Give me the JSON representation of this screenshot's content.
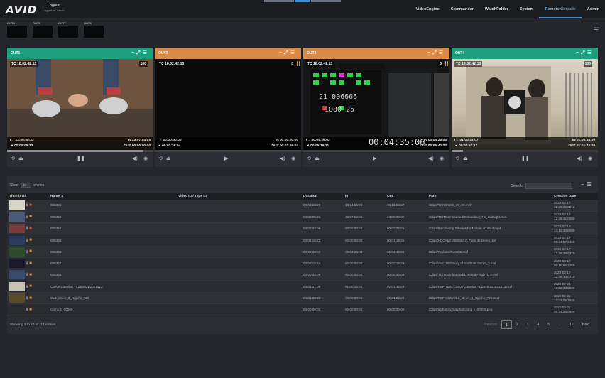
{
  "brand": {
    "logo": "AVID"
  },
  "user": {
    "name": "Logout",
    "status": "Logged as admin"
  },
  "nav": [
    "VideoEngine",
    "Commander",
    "WatchFolder",
    "System",
    "Remote Console",
    "Admin"
  ],
  "nav_active": "Remote Console",
  "outputs": [
    "OUT5",
    "OUT6",
    "OUT7",
    "OUT8"
  ],
  "channels": [
    {
      "name": "OUT1",
      "color": "#1f9e7d",
      "tc": "TC 18:02:42:13",
      "badge": "100",
      "l1": "I→ 23:59:58:33",
      "l2": "◄ 00:00:09:33",
      "r1": "IN 23:57:54:05",
      "r2": "OUT 00:00:00:00",
      "progress": 0.93
    },
    {
      "name": "OUT2",
      "color": "#d98b4a",
      "tc": "TC 18:02:42:13",
      "badge": "0",
      "l1": "I→ 00:00:00:00",
      "l2": "◄ 00:02:26:04",
      "r1": "IN 00:00:00:00",
      "r2": "OUT 00:02:26:04",
      "progress": 0.0
    },
    {
      "name": "OUT3",
      "color": "#d98b4a",
      "tc": "TC 18:02:42:13",
      "badge": "0",
      "l1": "I→ 00:04:25:03",
      "l2": "◄ 00:05:19:21",
      "r1": "IN 00:04:25:03",
      "r2": "OUT 00:05:44:04",
      "progress": 0.0,
      "overlay_tc": "00:04:35:06"
    },
    {
      "name": "OUT4",
      "color": "#1f9e7d",
      "tc": "TC 18:02:42:13",
      "badge": "100",
      "l1": "I→ 01:00:22:07",
      "l2": "◄ 00:00:51:17",
      "r1": "IN 01:00:15:00",
      "r2": "OUT 01:01:42:08",
      "progress": 0.08
    }
  ],
  "table": {
    "show_label": "Show",
    "show_value": "10",
    "entries_label": "entries",
    "search_label": "Search:",
    "columns": [
      "Thumbnail",
      "Name ▲",
      "Video ID / Tape ID",
      "Duration",
      "In",
      "Out",
      "Path",
      "Creation Date"
    ],
    "rows": [
      {
        "thumb": "#d8d4c8",
        "name": "005352",
        "duration": "00:04:23:26",
        "in": "16:14:55:56",
        "out": "16:19:23:27",
        "path": "/Clips/TC/720p50_s5_15.mxf",
        "date1": "2022-02-17",
        "date2": "12:29:29.0013",
        "lock": "lock-r"
      },
      {
        "thumb": "#4a5a7a",
        "name": "005353",
        "duration": "00:02:05:21",
        "in": "23:57:54:05",
        "out": "24:00:00:00",
        "path": "/Clips/TC/TCembedded/Embedded_TC_midnight.mov",
        "date1": "2022-02-17",
        "date2": "12:28:42.0080",
        "lock": "lock-o"
      },
      {
        "thumb": "#7a3a3a",
        "name": "005354",
        "duration": "00:02:26:06",
        "in": "00:00:00:00",
        "out": "00:02:26:05",
        "path": "/Clips/Introducing Sibelius for Mobile on iPad.mp4",
        "date1": "2022-02-17",
        "date2": "14:13:20.6090",
        "lock": "lock-r"
      },
      {
        "thumb": "#2a3a5a",
        "name": "005355",
        "duration": "00:01:16:22",
        "in": "00:00:00:00",
        "out": "00:01:16:21",
        "path": "/Clips/HDCAM/1080i50/LG Paris 4k Demo.mxf",
        "date1": "2022-02-17",
        "date2": "09:34:57.3420",
        "lock": "lock-o"
      },
      {
        "thumb": "#2c4a2c",
        "name": "005356",
        "duration": "00:00:20:00",
        "in": "00:04:25:04",
        "out": "00:04:45:03",
        "path": "/Clips/Pro/arte/Ruc026.mxf",
        "date1": "2022-02-17",
        "date2": "13:38:28.6370",
        "lock": "lock-o"
      },
      {
        "thumb": "#1a1a2a",
        "name": "005357",
        "duration": "00:02:15:24",
        "in": "00:00:00:00",
        "out": "00:02:15:23",
        "path": "/Clips/AVC/100/Story of Earth 4K Demo_3.mxf",
        "date1": "2022-02-17",
        "date2": "09:16:58.1280",
        "lock": "lock-o"
      },
      {
        "thumb": "#3a4a6a",
        "name": "005358",
        "duration": "00:00:30:06",
        "in": "00:00:00:00",
        "out": "00:00:30:05",
        "path": "/Clips/TC/TCembedded/1_Blende_sub_1_2.mxf",
        "date1": "2022-02-17",
        "date2": "12:38:34.0710",
        "lock": "lock-o"
      },
      {
        "thumb": "#c8c4b4",
        "name": "Carlos Casellas - LZ539DE2021013",
        "duration": "00:01:27:09",
        "in": "01:00:15:00",
        "out": "01:01:42:08",
        "path": "/Clips/FSP-7884/Carlos Casellas - LZ539DE2021013.mxf",
        "date1": "2022-02-21",
        "date2": "17:32:33.9930",
        "lock": "lock-o"
      },
      {
        "thumb": "#5a4a2a",
        "name": "CL2_ideen_3_Hgjohs_720",
        "duration": "00:01:22:30",
        "in": "00:00:00:00",
        "out": "00:01:22:28",
        "path": "/Clips/FSP-8443/CL2_ideen_3_Hgjohs_720.mp4",
        "date1": "2022-02-21",
        "date2": "17:33:08.3640",
        "lock": "lock-o"
      },
      {
        "thumb": "#2a2c30",
        "name": "Comp 1_00000",
        "duration": "00:00:00:01",
        "in": "00:00:00:00",
        "out": "00:00:00:00",
        "path": "/Clips/alpha/png/calpha/Comp 1_00000.png",
        "date1": "2022-02-21",
        "date2": "08:34:28.0990",
        "lock": "lock-o"
      }
    ],
    "info": "Showing 1 to 10 of 117 entries",
    "pager": [
      "Previous",
      "1",
      "2",
      "3",
      "4",
      "5",
      "...",
      "12",
      "Next"
    ]
  }
}
